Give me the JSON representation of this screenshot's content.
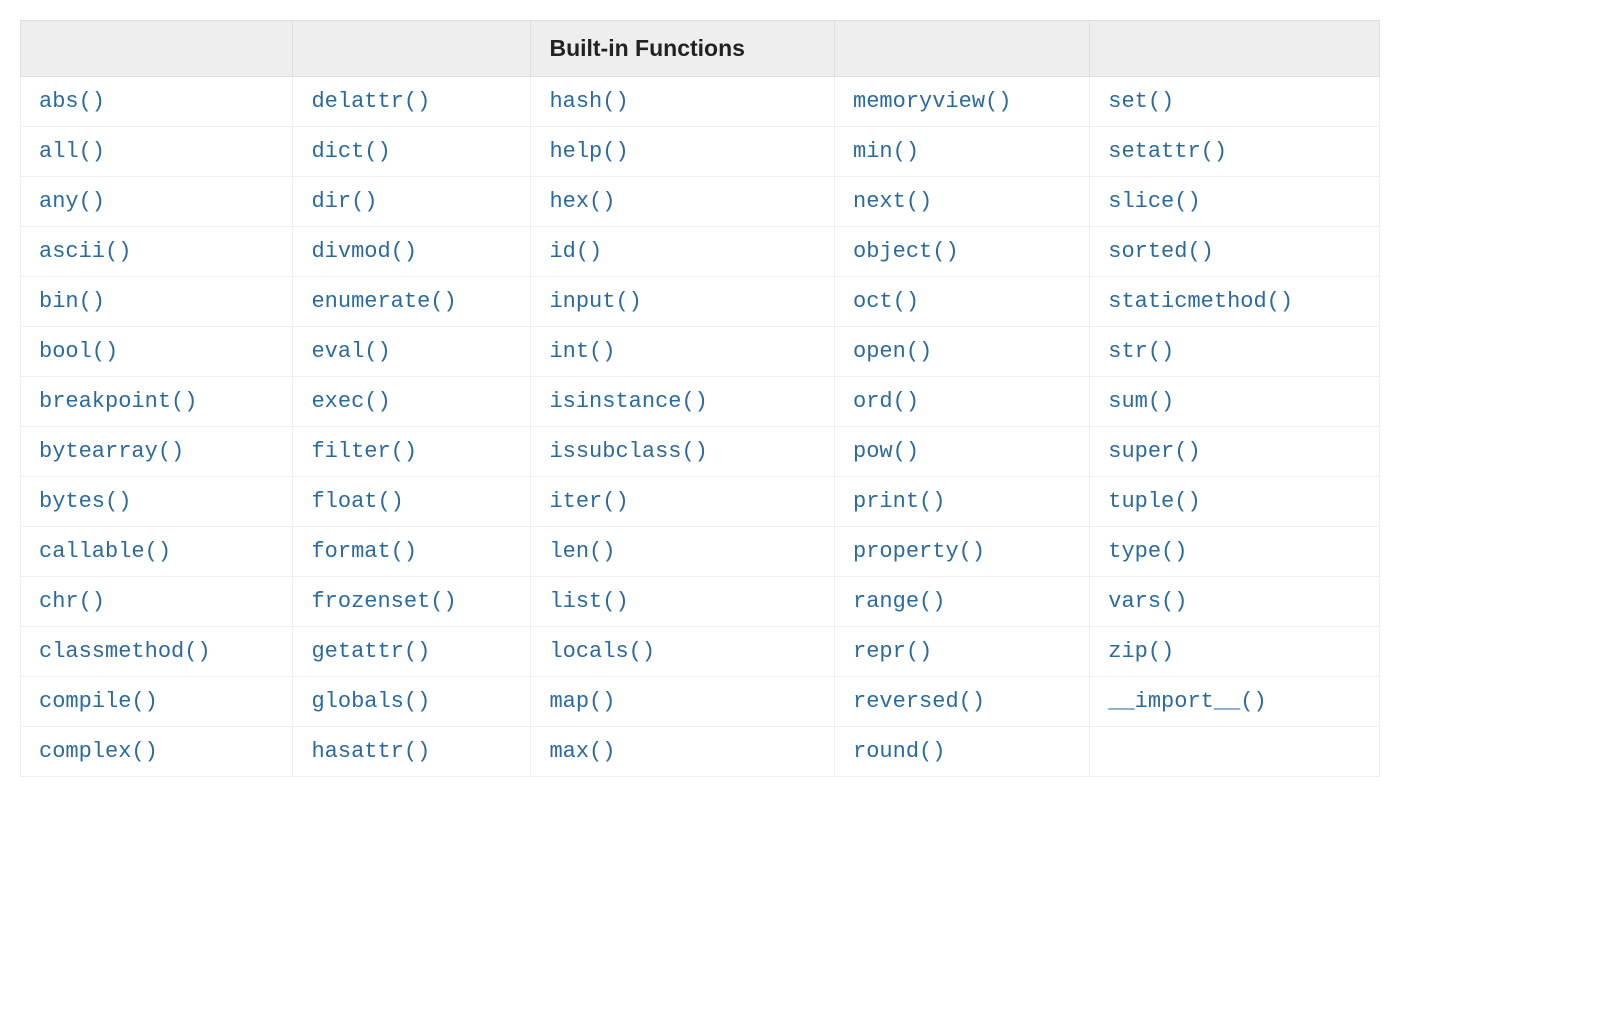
{
  "header": {
    "col0": "",
    "col1": "",
    "col2": "Built-in Functions",
    "col3": "",
    "col4": ""
  },
  "table": {
    "columns": [
      [
        "abs()",
        "all()",
        "any()",
        "ascii()",
        "bin()",
        "bool()",
        "breakpoint()",
        "bytearray()",
        "bytes()",
        "callable()",
        "chr()",
        "classmethod()",
        "compile()",
        "complex()"
      ],
      [
        "delattr()",
        "dict()",
        "dir()",
        "divmod()",
        "enumerate()",
        "eval()",
        "exec()",
        "filter()",
        "float()",
        "format()",
        "frozenset()",
        "getattr()",
        "globals()",
        "hasattr()"
      ],
      [
        "hash()",
        "help()",
        "hex()",
        "id()",
        "input()",
        "int()",
        "isinstance()",
        "issubclass()",
        "iter()",
        "len()",
        "list()",
        "locals()",
        "map()",
        "max()"
      ],
      [
        "memoryview()",
        "min()",
        "next()",
        "object()",
        "oct()",
        "open()",
        "ord()",
        "pow()",
        "print()",
        "property()",
        "range()",
        "repr()",
        "reversed()",
        "round()"
      ],
      [
        "set()",
        "setattr()",
        "slice()",
        "sorted()",
        "staticmethod()",
        "str()",
        "sum()",
        "super()",
        "tuple()",
        "type()",
        "vars()",
        "zip()",
        "__import__()",
        ""
      ]
    ]
  }
}
